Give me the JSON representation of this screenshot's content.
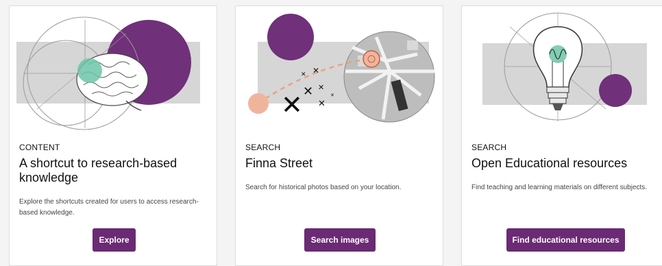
{
  "cards": [
    {
      "category": "CONTENT",
      "title": "A shortcut to research-based knowledge",
      "description": "Explore the shortcuts created for users to access research-based knowledge.",
      "button_label": "Explore",
      "illustration": "brain-illustration"
    },
    {
      "category": "SEARCH",
      "title": "Finna Street",
      "description": "Search for historical photos based on your location.",
      "button_label": "Search images",
      "illustration": "street-map-illustration"
    },
    {
      "category": "SEARCH",
      "title": "Open Educational resources",
      "description": "Find teaching and learning materials on different subjects.",
      "button_label": "Find educational resources",
      "illustration": "lightbulb-illustration"
    }
  ],
  "colors": {
    "accent": "#6b2a74",
    "illustration_purple": "#70307a",
    "illustration_green": "#6cc4a8",
    "illustration_peach": "#f0b49c"
  }
}
